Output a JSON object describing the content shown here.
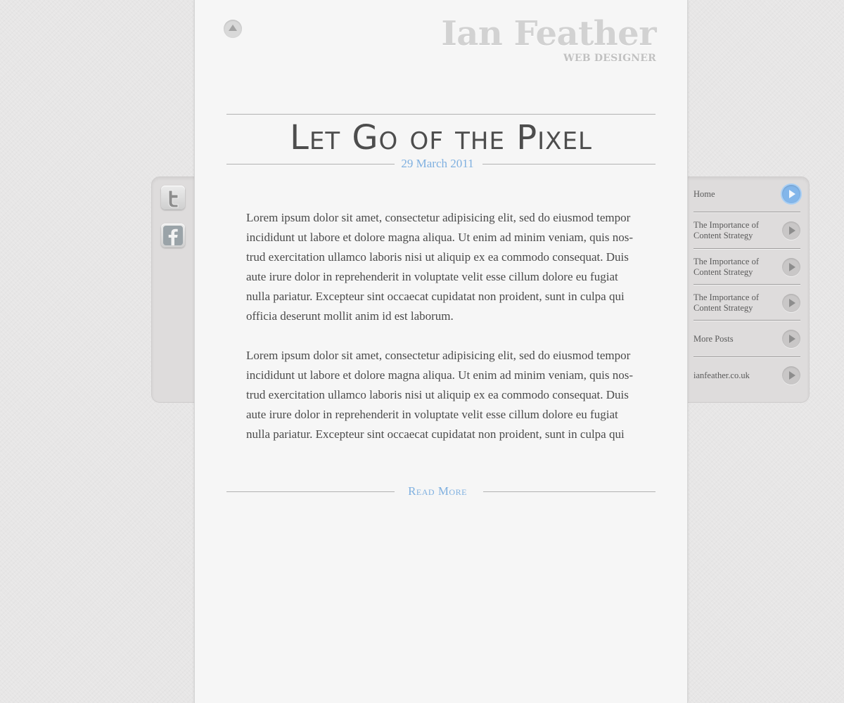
{
  "header": {
    "logo_name": "Ian Feather",
    "logo_subtitle": "WEB DESIGNER",
    "scroll_top_icon": "arrow-up-icon"
  },
  "post": {
    "title": "Let Go of the Pixel",
    "date": "29 March 2011",
    "paragraphs": [
      "Lorem ipsum dolor sit amet, consectetur adipisicing elit, sed do eiusmod tempor incididunt ut labore et dolore magna aliqua. Ut enim ad minim veniam, quis nos-trud exercitation ullamco laboris nisi ut aliquip ex ea commodo consequat. Duis aute irure dolor in reprehenderit in voluptate velit esse cillum dolore eu fugiat nulla pariatur. Excepteur sint occaecat cupidatat non proident, sunt in culpa qui officia deserunt mollit anim id est laborum.",
      "Lorem ipsum dolor sit amet, consectetur adipisicing elit, sed do eiusmod tempor incididunt ut labore et dolore magna aliqua. Ut enim ad minim veniam, quis nos-trud exercitation ullamco laboris nisi ut aliquip ex ea commodo consequat. Duis aute irure dolor in reprehenderit in voluptate velit esse cillum dolore eu fugiat nulla pariatur. Excepteur sint occaecat cupidatat non proident, sunt in culpa qui"
    ],
    "read_more": "Read More"
  },
  "social": {
    "items": [
      {
        "name": "twitter",
        "icon": "twitter-icon"
      },
      {
        "name": "facebook",
        "icon": "facebook-icon"
      }
    ]
  },
  "nav": {
    "items": [
      {
        "label": "Home",
        "active": true
      },
      {
        "label": "The Importance of Content Strategy",
        "active": false
      },
      {
        "label": "The Importance of Content Strategy",
        "active": false
      },
      {
        "label": "The Importance of Content Strategy",
        "active": false
      },
      {
        "label": "More Posts",
        "active": false
      },
      {
        "label": "ianfeather.co.uk",
        "active": false
      }
    ]
  },
  "colors": {
    "accent": "#7fb0e0",
    "page_background": "#f6f6f6",
    "body_background": "#e7e6e6",
    "text": "#4a4a4a",
    "logo": "#d2d2d2"
  }
}
